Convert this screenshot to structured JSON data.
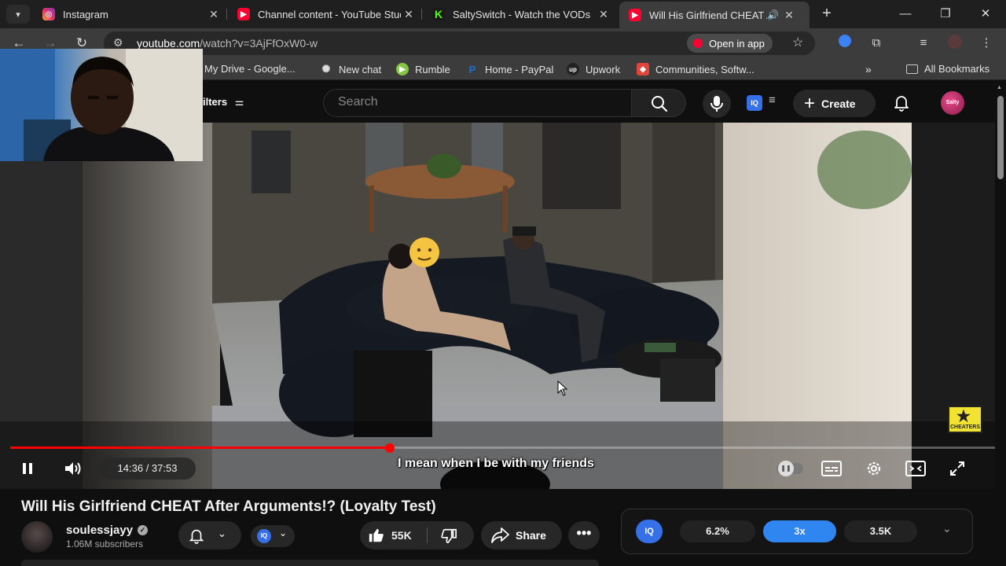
{
  "browser": {
    "tabs": [
      {
        "title": "Instagram",
        "active": false
      },
      {
        "title": "Channel content - YouTube Studio",
        "active": false
      },
      {
        "title": "SaltySwitch - Watch the VODs",
        "active": false
      },
      {
        "title": "Will His Girlfriend CHEAT After Arguments!?",
        "active": true
      }
    ],
    "url_domain": "youtube.com",
    "url_path": "/watch?v=3AjFfOxW0-w",
    "open_in_app": "Open in app",
    "bookmarks": [
      {
        "label": "My Drive - Google..."
      },
      {
        "label": "New chat"
      },
      {
        "label": "Rumble"
      },
      {
        "label": "Home - PayPal"
      },
      {
        "label": "Upwork"
      },
      {
        "label": "Communities, Softw..."
      }
    ],
    "all_bookmarks": "All Bookmarks"
  },
  "youtube": {
    "filters_label": "ilters",
    "search_placeholder": "Search",
    "create_label": "Create",
    "avatar_label": "Salty"
  },
  "player": {
    "time": "14:36 / 37:53",
    "progress": 0.385,
    "caption": "I mean when I be with my friends",
    "watermark": "CHEATERS"
  },
  "video": {
    "title": "Will His Girlfriend CHEAT After Arguments!? (Loyalty Test)",
    "channel": "soulessjayy",
    "subscribers": "1.06M subscribers",
    "likes": "55K",
    "share_label": "Share"
  },
  "iq_panel": {
    "logo": "IQ",
    "stats": [
      "6.2%",
      "3x",
      "3.5K"
    ]
  },
  "colors": {
    "accent_red": "#ff0000",
    "iq_blue": "#2f86f0"
  }
}
